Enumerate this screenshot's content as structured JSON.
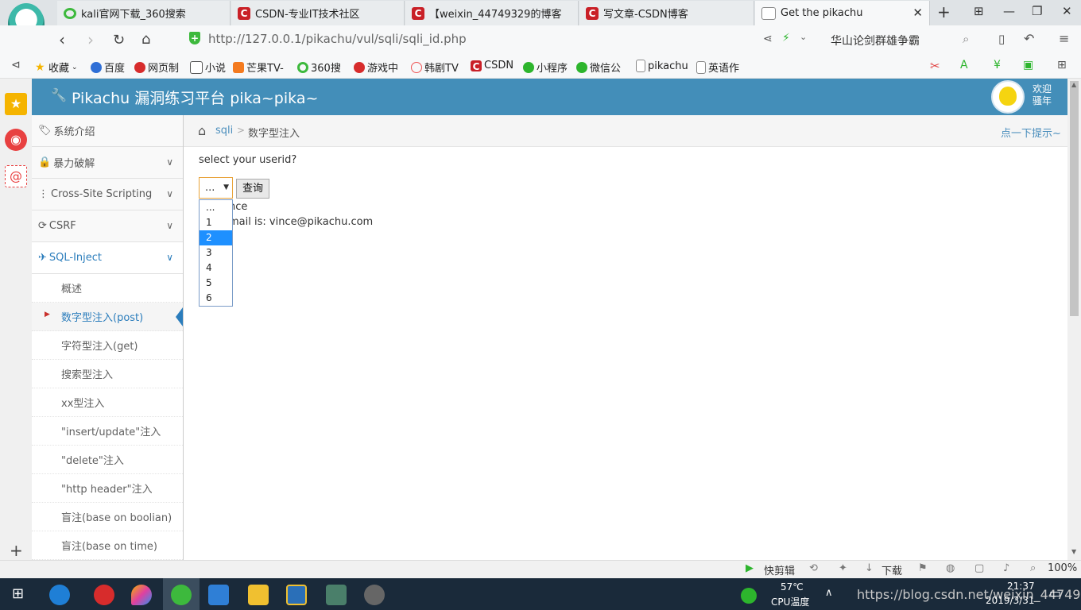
{
  "browser": {
    "tabs": [
      {
        "title": "kali官网下载_360搜索",
        "icon": "360-search-icon"
      },
      {
        "title": "CSDN-专业IT技术社区",
        "icon": "csdn-icon"
      },
      {
        "title": "【weixin_44749329的博客",
        "icon": "csdn-icon"
      },
      {
        "title": "写文章-CSDN博客",
        "icon": "csdn-icon"
      },
      {
        "title": "Get the pikachu",
        "icon": "document-icon",
        "active": true
      }
    ],
    "url": "http://127.0.0.1/pikachu/vul/sqli/sqli_id.php",
    "search_text": "华山论剑群雄争霸",
    "bookmarks": [
      "收藏",
      "百度",
      "网页制",
      "小说",
      "芒果TV-",
      "360搜",
      "游戏中",
      "韩剧TV",
      "CSDN",
      "小程序",
      "微信公",
      "pikachu",
      "英语作"
    ]
  },
  "app": {
    "title": "Pikachu 漏洞练习平台 pika~pika~",
    "welcome_line1": "欢迎",
    "welcome_line2": "骚年",
    "accent": "#438eb9"
  },
  "menu": {
    "items": [
      {
        "label": "系统介绍"
      },
      {
        "label": "暴力破解"
      },
      {
        "label": "Cross-Site Scripting"
      },
      {
        "label": "CSRF"
      },
      {
        "label": "SQL-Inject"
      }
    ],
    "subitems": [
      "概述",
      "数字型注入(post)",
      "字符型注入(get)",
      "搜索型注入",
      "xx型注入",
      "\"insert/update\"注入",
      "\"delete\"注入",
      "\"http header\"注入",
      "盲注(base on boolian)",
      "盲注(base on time)"
    ]
  },
  "breadcrumb": {
    "section": "sqli",
    "separator": ">",
    "page": "数字型注入",
    "hint": "点一下提示~"
  },
  "form": {
    "prompt": "select your userid?",
    "selected": "...",
    "options": [
      "...",
      "1",
      "2",
      "3",
      "4",
      "5",
      "6"
    ],
    "highlighted_option": "2",
    "submit_label": "查询",
    "result_line1": "nce",
    "result_line2": "mail is: vince@pikachu.com"
  },
  "statusbar": {
    "clip_label": "快剪辑",
    "download_label": "下载",
    "zoom": "100%"
  },
  "taskbar": {
    "temperature": "57℃",
    "cpu_label": "CPU温度",
    "time": "21:37",
    "date": "2019/3/31",
    "watermark": "https://blog.csdn.net/weixin_44749329"
  }
}
